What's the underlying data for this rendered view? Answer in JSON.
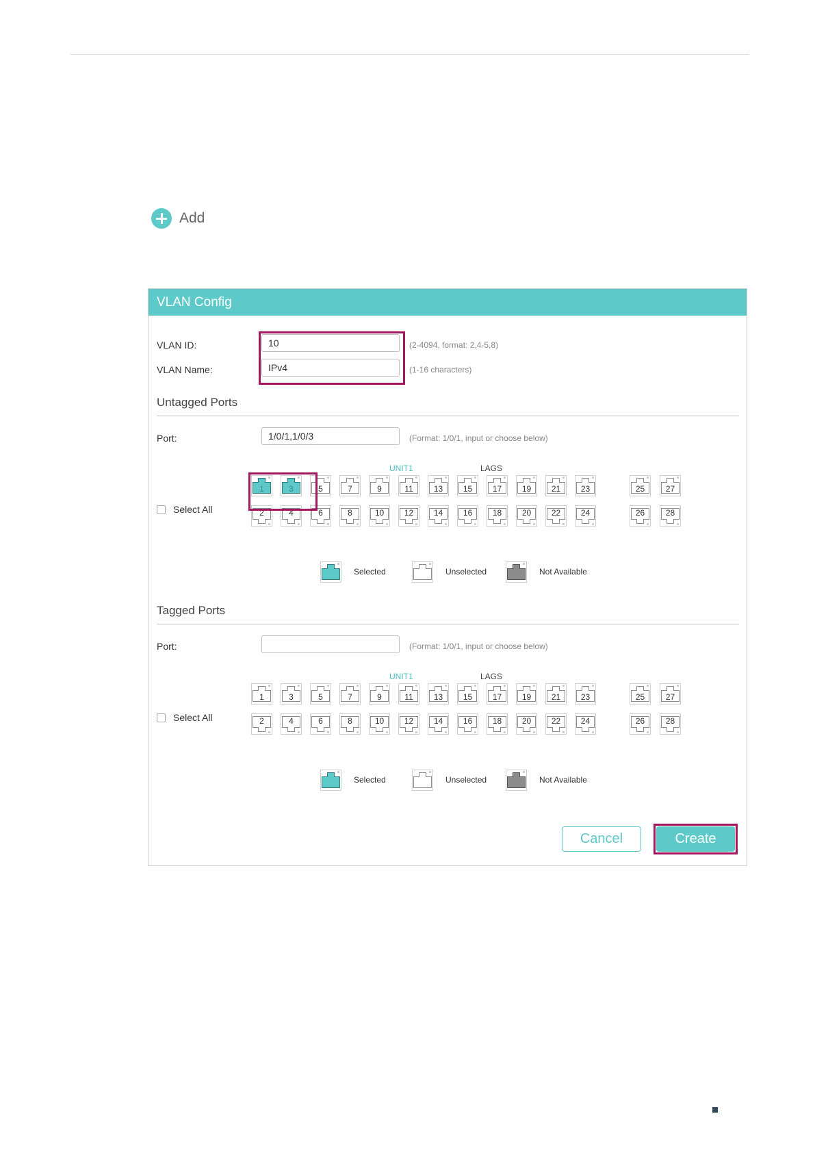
{
  "toolbar": {
    "add_label": "Add"
  },
  "panel": {
    "title": "VLAN Config"
  },
  "vlan_id": {
    "label": "VLAN ID:",
    "value": "10",
    "hint": "(2-4094, format: 2,4-5,8)"
  },
  "vlan_name": {
    "label": "VLAN Name:",
    "value": "IPv4",
    "hint": "(1-16 characters)"
  },
  "untagged": {
    "title": "Untagged Ports",
    "port_label": "Port:",
    "port_value": "1/0/1,1/0/3",
    "port_hint": "(Format: 1/0/1, input or choose below)",
    "select_all": "Select All",
    "unit_label": "UNIT1",
    "lags_label": "LAGS",
    "selected_ports": [
      1,
      3
    ]
  },
  "tagged": {
    "title": "Tagged Ports",
    "port_label": "Port:",
    "port_value": "",
    "port_hint": "(Format: 1/0/1, input or choose below)",
    "select_all": "Select All",
    "unit_label": "UNIT1",
    "lags_label": "LAGS",
    "selected_ports": []
  },
  "ports": {
    "unit_top": [
      "1",
      "3",
      "5",
      "7",
      "9",
      "11",
      "13",
      "15",
      "17",
      "19",
      "21",
      "23"
    ],
    "unit_bottom": [
      "2",
      "4",
      "6",
      "8",
      "10",
      "12",
      "14",
      "16",
      "18",
      "20",
      "22",
      "24"
    ],
    "sfp_top": [
      "25",
      "27"
    ],
    "sfp_bottom": [
      "26",
      "28"
    ]
  },
  "legend": {
    "selected": "Selected",
    "unselected": "Unselected",
    "not_available": "Not Available"
  },
  "buttons": {
    "cancel": "Cancel",
    "create": "Create"
  },
  "colors": {
    "accent": "#5ec9c9",
    "highlight": "#a2175e",
    "not_available": "#8c8c8c"
  }
}
